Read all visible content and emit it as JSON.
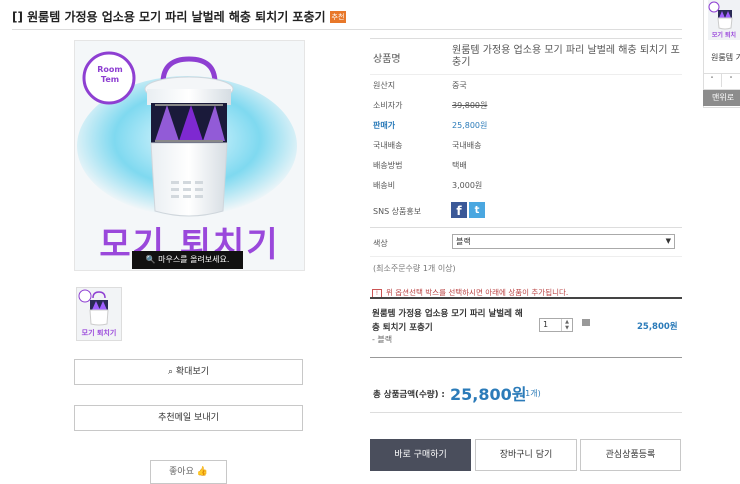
{
  "title": {
    "text": "[] 원룸템 가정용 업소용 모기 파리 날벌레 해충 퇴치기 포충기",
    "badge": "추천"
  },
  "image": {
    "logo_line1": "Room",
    "logo_line2": "Tem",
    "caption": "모기 퇴치기",
    "zoom_hint": "마우스를 올려보세요."
  },
  "buttons": {
    "zoom": "확대보기",
    "recommend": "추천메일 보내기",
    "like": "좋아요",
    "buy": "바로 구매하기",
    "cart": "장바구니 담기",
    "wish": "관심상품등록"
  },
  "info": {
    "product_name_label": "상품명",
    "product_name_value": "원룸템 가정용 업소용 모기 파리 날벌레 해충 퇴치기 포충기",
    "origin_label": "원산지",
    "origin_value": "중국",
    "consumer_price_label": "소비자가",
    "consumer_price_value": "39,800원",
    "sale_price_label": "판매가",
    "sale_price_value": "25,800원",
    "domestic_label": "국내배송",
    "domestic_value": "국내배송",
    "shipping_method_label": "배송방법",
    "shipping_method_value": "택배",
    "shipping_fee_label": "배송비",
    "shipping_fee_value": "3,000원",
    "sns_label": "SNS 상품홍보",
    "color_label": "색상",
    "color_value": "블랙",
    "min_order": "(최소주문수량 1개 이상)",
    "notice": "위 옵션선택 박스를 선택하시면 아래에 상품이 추가됩니다."
  },
  "selected": {
    "name_line1": "원룸템 가정용 업소용 모기 파리 날벌레 해",
    "name_line2": "충 퇴치기 포충기",
    "option": "- 블랙",
    "qty": "1",
    "price": "25,800원"
  },
  "total": {
    "label": "총 상품금액(수량) :",
    "amount": "25,800원",
    "count": "(1개)"
  },
  "sidebar": {
    "name": "원룸템 가",
    "up": "˄",
    "down": "˅",
    "top": "맨위로"
  },
  "colors": {
    "sale_blue": "#2b7bb9",
    "buy_bg": "#4a4e5c",
    "purple": "#8b3fd0",
    "facebook": "#3b5998",
    "twitter": "#4aa7e0"
  }
}
